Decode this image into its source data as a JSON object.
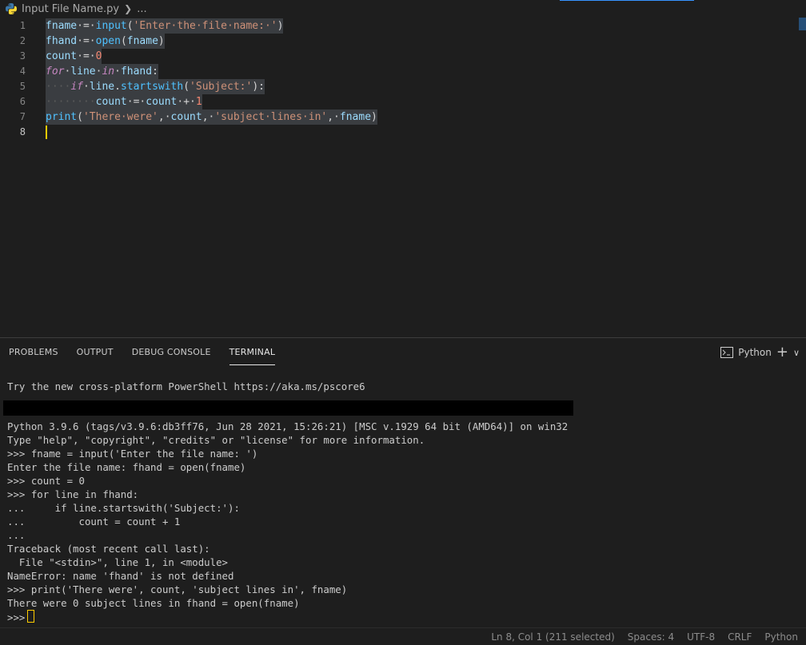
{
  "breadcrumb": {
    "file": "Input File Name.py",
    "more": "..."
  },
  "editor": {
    "line_numbers": [
      "1",
      "2",
      "3",
      "4",
      "5",
      "6",
      "7",
      "8"
    ],
    "lines": [
      [
        {
          "t": "fname",
          "c": "var"
        },
        {
          "t": " = ",
          "c": "op"
        },
        {
          "t": "input",
          "c": "fn"
        },
        {
          "t": "(",
          "c": "op"
        },
        {
          "t": "'Enter the file name: '",
          "c": "str"
        },
        {
          "t": ")",
          "c": "op"
        }
      ],
      [
        {
          "t": "fhand",
          "c": "var"
        },
        {
          "t": " = ",
          "c": "op"
        },
        {
          "t": "open",
          "c": "fn"
        },
        {
          "t": "(",
          "c": "op"
        },
        {
          "t": "fname",
          "c": "var"
        },
        {
          "t": ")",
          "c": "op"
        }
      ],
      [
        {
          "t": "count",
          "c": "var"
        },
        {
          "t": " = ",
          "c": "op"
        },
        {
          "t": "0",
          "c": "num-r"
        }
      ],
      [
        {
          "t": "for",
          "c": "kw-ctrl"
        },
        {
          "t": " ",
          "c": "op"
        },
        {
          "t": "line",
          "c": "var"
        },
        {
          "t": " ",
          "c": "op"
        },
        {
          "t": "in",
          "c": "kw-ctrl"
        },
        {
          "t": " ",
          "c": "op"
        },
        {
          "t": "fhand",
          "c": "var"
        },
        {
          "t": ":",
          "c": "op"
        }
      ],
      [
        {
          "t": "    ",
          "c": "dot"
        },
        {
          "t": "if",
          "c": "kw-ctrl"
        },
        {
          "t": " ",
          "c": "op"
        },
        {
          "t": "line",
          "c": "var"
        },
        {
          "t": ".",
          "c": "op"
        },
        {
          "t": "startswith",
          "c": "fn"
        },
        {
          "t": "(",
          "c": "op"
        },
        {
          "t": "'Subject:'",
          "c": "str"
        },
        {
          "t": "):",
          "c": "op"
        }
      ],
      [
        {
          "t": "        ",
          "c": "dot"
        },
        {
          "t": "count",
          "c": "var"
        },
        {
          "t": " = ",
          "c": "op"
        },
        {
          "t": "count",
          "c": "var"
        },
        {
          "t": " + ",
          "c": "op"
        },
        {
          "t": "1",
          "c": "num-r"
        }
      ],
      [
        {
          "t": "print",
          "c": "fn"
        },
        {
          "t": "(",
          "c": "op"
        },
        {
          "t": "'There were'",
          "c": "str"
        },
        {
          "t": ", ",
          "c": "op"
        },
        {
          "t": "count",
          "c": "var"
        },
        {
          "t": ", ",
          "c": "op"
        },
        {
          "t": "'subject lines in'",
          "c": "str"
        },
        {
          "t": ", ",
          "c": "op"
        },
        {
          "t": "fname",
          "c": "var"
        },
        {
          "t": ")",
          "c": "op"
        }
      ],
      []
    ]
  },
  "panel": {
    "tabs": [
      "PROBLEMS",
      "OUTPUT",
      "DEBUG CONSOLE",
      "TERMINAL"
    ],
    "active_tab": "TERMINAL",
    "terminal_name": "Python",
    "plus": "+",
    "chevron": "∨"
  },
  "terminal": {
    "lines_before_bar": [
      "Try the new cross-platform PowerShell https://aka.ms/pscore6"
    ],
    "lines_after_bar": [
      "Python 3.9.6 (tags/v3.9.6:db3ff76, Jun 28 2021, 15:26:21) [MSC v.1929 64 bit (AMD64)] on win32",
      "Type \"help\", \"copyright\", \"credits\" or \"license\" for more information.",
      ">>> fname = input('Enter the file name: ')",
      "Enter the file name: fhand = open(fname)",
      ">>> count = 0",
      ">>> for line in fhand:",
      "...     if line.startswith('Subject:'):",
      "...         count = count + 1",
      "...",
      "Traceback (most recent call last):",
      "  File \"<stdin>\", line 1, in <module>",
      "NameError: name 'fhand' is not defined",
      ">>> print('There were', count, 'subject lines in', fname)",
      "There were 0 subject lines in fhand = open(fname)"
    ],
    "prompt": ">>> "
  },
  "status": {
    "position": "Ln 8, Col 1 (211 selected)",
    "spaces": "Spaces: 4",
    "encoding": "UTF-8",
    "eol": "CRLF",
    "language": "Python"
  },
  "colors": {
    "background": "#1e1e1e",
    "selection": "#3a3d41",
    "cursor": "#ffcc00",
    "accent": "#3794ff"
  }
}
